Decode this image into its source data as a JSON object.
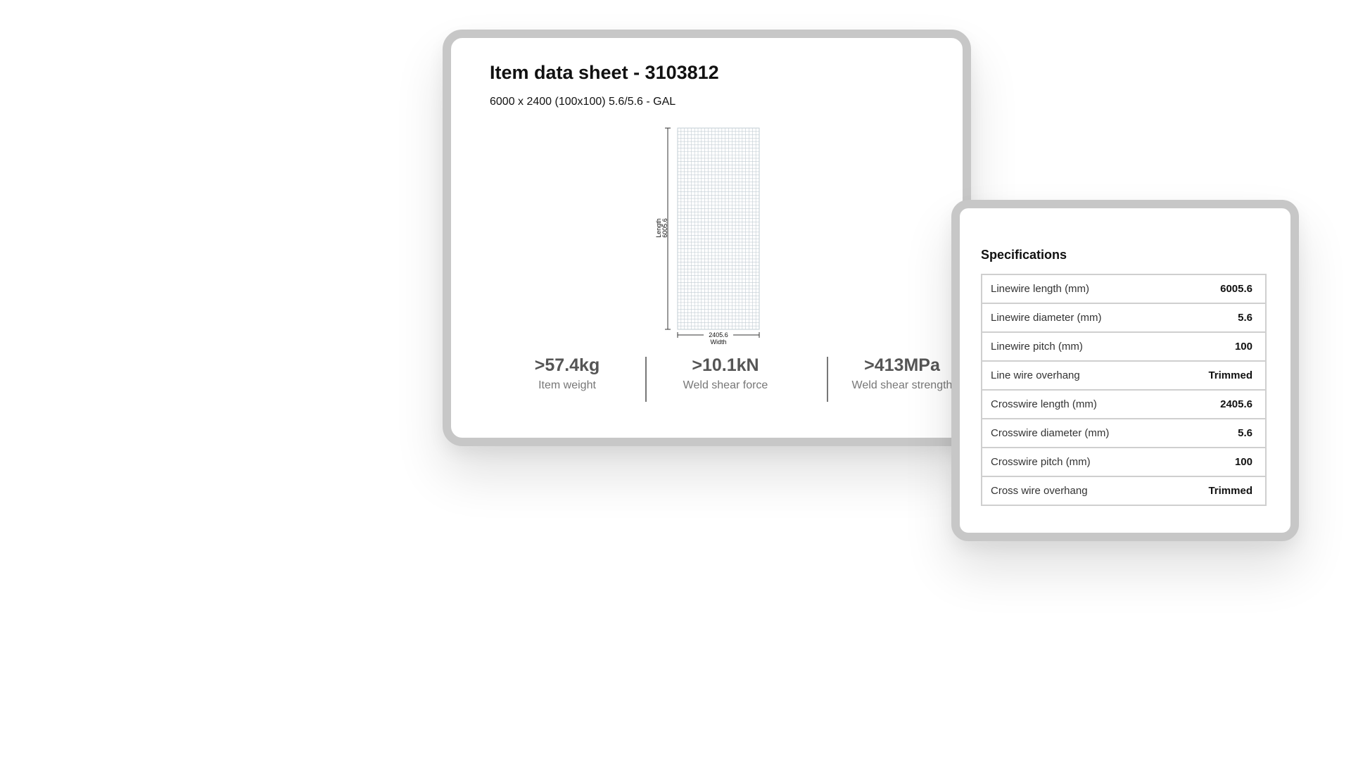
{
  "sheet": {
    "title": "Item data sheet - 3103812",
    "subtitle": "6000 x 2400 (100x100) 5.6/5.6 - GAL",
    "diagram": {
      "length_label": "Length",
      "length_value": "6005.6",
      "width_label": "Width",
      "width_value": "2405.6"
    },
    "stats": [
      {
        "value": ">57.4kg",
        "label": "Item weight"
      },
      {
        "value": ">10.1kN",
        "label": "Weld shear force"
      },
      {
        "value": ">413MPa",
        "label": "Weld shear strength"
      }
    ]
  },
  "specifications": {
    "title": "Specifications",
    "rows": [
      {
        "label": "Linewire length (mm)",
        "value": "6005.6"
      },
      {
        "label": "Linewire diameter (mm)",
        "value": "5.6"
      },
      {
        "label": "Linewire pitch (mm)",
        "value": "100"
      },
      {
        "label": "Line wire overhang",
        "value": "Trimmed"
      },
      {
        "label": "Crosswire length (mm)",
        "value": "2405.6"
      },
      {
        "label": "Crosswire diameter (mm)",
        "value": "5.6"
      },
      {
        "label": "Crosswire pitch (mm)",
        "value": "100"
      },
      {
        "label": "Cross wire overhang",
        "value": "Trimmed"
      }
    ]
  },
  "colors": {
    "card_border": "#c7c7c7",
    "mesh_line": "#c2ccd3",
    "stat_value": "#555555",
    "stat_label": "#777777"
  }
}
